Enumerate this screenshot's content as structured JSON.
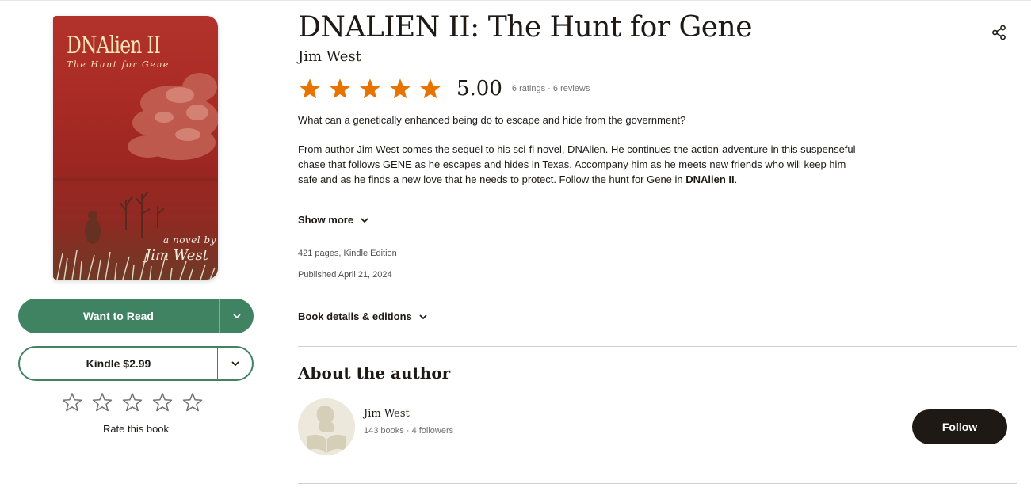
{
  "book": {
    "title": "DNALIEN II: The Hunt for Gene",
    "author": "Jim West",
    "rating": {
      "average": "5.00",
      "stars_filled": 5,
      "ratings_count": "6 ratings",
      "separator": "·",
      "reviews_count": "6 reviews"
    },
    "description": {
      "lead": "What can a genetically enhanced being do to escape and hide from the government?",
      "body": "From author Jim West comes the sequel to his sci-fi novel, DNAlien. He continues the action-adventure in this suspenseful chase that follows GENE as he escapes and hides in Texas. Accompany him as he meets new friends who will keep him safe and as he finds a new love that he needs to protect. Follow the hunt for Gene in ",
      "body_bold": "DNAlien II",
      "body_end": "."
    },
    "show_more_label": "Show more",
    "pages_format": "421 pages, Kindle Edition",
    "published": "Published April 21, 2024",
    "details_label": "Book details & editions",
    "cover": {
      "title": "DNAlien II",
      "subtitle": "The Hunt for Gene",
      "tagline": "a novel by",
      "author": "Jim West"
    }
  },
  "actions": {
    "want_to_read": "Want to Read",
    "kindle": "Kindle $2.99",
    "rate_label": "Rate this book"
  },
  "about": {
    "heading": "About the author",
    "author_name": "Jim West",
    "books": "143 books",
    "separator": "·",
    "followers": "4 followers",
    "follow_label": "Follow"
  },
  "colors": {
    "star": "#e87400",
    "green": "#3f8363",
    "dark": "#1e1915"
  },
  "icons": [
    "share-icon",
    "chevron-down-icon",
    "star-icon",
    "star-outline-icon",
    "author-placeholder-icon"
  ]
}
